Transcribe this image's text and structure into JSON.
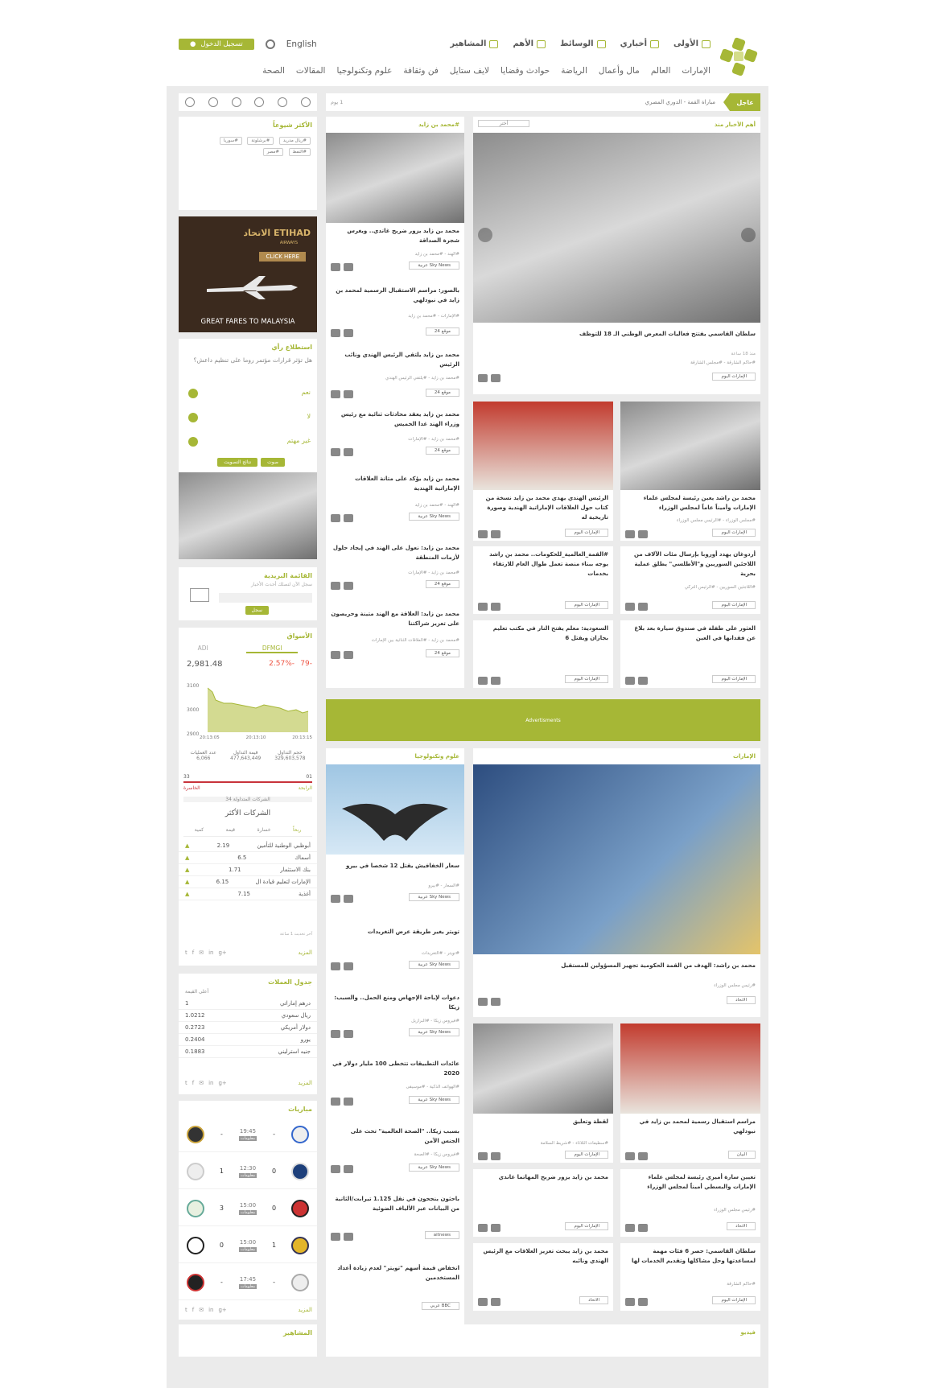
{
  "header": {
    "login_label": "تسجيل الدخول",
    "lang": "English",
    "main_nav": [
      "الأولى",
      "أخباري",
      "الوسائط",
      "الأهم",
      "المشاهير"
    ],
    "sec_nav": [
      "الإمارات",
      "العالم",
      "مال وأعمال",
      "الرياضة",
      "حوادث وقضايا",
      "لايف ستايل",
      "فن وثقافة",
      "علوم وتكنولوجيا",
      "المقالات",
      "الصحة"
    ]
  },
  "ticker": {
    "label": "عاجل",
    "text": "مباراة القمة - الدوري المصري",
    "time": "1 يوم"
  },
  "hero": {
    "section": "أهم الأخبار منذ",
    "filter": "أختر",
    "title": "سلطان القاسمي يفتتح فعاليات المعرض الوطني الـ 18 للتوظف",
    "meta": "منذ 18 ساعة",
    "tag": "#حاكم الشارقة - #مجلس الشارقة",
    "source": "الإمارات اليوم"
  },
  "mid_header": "#محمد بن زايد",
  "mid_cards": [
    {
      "title": "محمد بن زايد يزور ضريح غاندي.. ويغرس شجرة الصداقة",
      "tag": "#الهند - #محمد بن زايد",
      "source": "Sky News عربية"
    },
    {
      "title": "بالصور: مراسم الاستقبال الرسمية لمحمد بن زايد في نيودلهي",
      "tag": "#الإمارات - #محمد بن زايد",
      "source": "موقع 24"
    },
    {
      "title": "محمد بن زايد يلتقي الرئيس الهندي ونائب الرئيس",
      "tag": "#محمد بن زايد - #يلتقي الرئيس الهندي",
      "source": "موقع 24"
    },
    {
      "title": "محمد بن زايد يعقد محادثات ثنائية مع رئيس وزراء الهند غدا الخميس",
      "tag": "#محمد بن زايد - #الإمارات",
      "source": "موقع 24"
    },
    {
      "title": "محمد بن زايد يؤكد على متانة العلاقات الإماراتية الهندية",
      "tag": "#الهند - #محمد بن زايد",
      "source": "Sky News عربية"
    },
    {
      "title": "محمد بن زايد: نعول على الهند في إيجاد حلول لأزمات المنطقة",
      "tag": "#محمد بن زايد - #الإمارات",
      "source": "موقع 24"
    },
    {
      "title": "محمد بن زايد: العلاقة مع الهند متينة وحريصون على تعزيز شراكتنا",
      "tag": "#محمد بن زايد - #العلاقات الثنائية بين الإمارات",
      "source": "موقع 24"
    }
  ],
  "grid_cards": [
    {
      "title": "محمد بن راشد يعين رئيسة لمجلس علماء الإمارات وأميناً عاماً لمجلس الوزراء",
      "tag": "#مجلس الوزراء - #الرئيس مجلس الوزراء",
      "source": "الإمارات اليوم"
    },
    {
      "title": "الرئيس الهندي يهدي محمد بن زايد نسخة من كتاب حول العلاقات الإماراتية الهندية وصورة تاريخية له",
      "tag": "",
      "source": "الإمارات اليوم"
    },
    {
      "title": "أردوغان يهدد أوروبا بإرسال مئات الآلاف من اللاجئين السوريين و\"الأطلسي\" يطلق عملية بحرية",
      "tag": "#اللاجئين السوريين - #الرئيس التركي",
      "source": "الإمارات اليوم"
    },
    {
      "title": "#القمة_العالمية_للحكومات.. محمد بن راشد يوجه ببناء منصة تعمل طوال العام للارتقاء بخدمات",
      "tag": "",
      "source": "الإمارات اليوم"
    },
    {
      "title": "العثور على طفلة في صندوق سيارة بعد بلاغ عن فقدانها في العين",
      "tag": "",
      "source": "الإمارات اليوم"
    },
    {
      "title": "السعودية: معلم يفتح النار في مكتب تعليم بجازان ويقتل 6",
      "tag": "",
      "source": "الإمارات اليوم"
    }
  ],
  "ad_label": "Advertisments",
  "tech_header": "علوم وتكنولوجيا",
  "tech_cards": [
    {
      "title": "سعار الخفافيش يقتل 12 شخصا في بيرو",
      "tag": "#السعار - #بيرو",
      "source": "Sky News عربية"
    },
    {
      "title": "تويتر يغير طريقة عرض التغريدات",
      "tag": "#تويتر - #التغريدات",
      "source": "Sky News عربية"
    },
    {
      "title": "دعوات لإباحة الإجهاض ومنع الحمل.. والسبب: زيكا",
      "tag": "#فيروس زيكا - #البرازيل",
      "source": "Sky News عربية"
    },
    {
      "title": "عائدات التطبيقات تتخطى 100 مليار دولار في 2020",
      "tag": "#الهواتف الذكية - #موسيقى",
      "source": "Sky News عربية"
    },
    {
      "title": "بسبب زيكا.. \"الصحة العالمية\" تحث على الجنس الآمن",
      "tag": "#فيروس زيكا - #الصحة",
      "source": "Sky News عربية"
    },
    {
      "title": "باحثون ينجحون في نقل 1.125 تيرابت/الثانية من البيانات عبر الألياف الضوئية",
      "tag": "",
      "source": "aitnews"
    },
    {
      "title": "انخفاض قيمة أسهم \"تويتر\" لعدم زيادة أعداد المستخدمين",
      "tag": "",
      "source": "BBC عربي"
    }
  ],
  "uae_header": "الإمارات",
  "uae_hero": {
    "title": "محمد بن راشد: الهدف من القمة الحكومية تجهيز المسؤولين للمستقبل",
    "tag": "#رئيس مجلس الوزراء",
    "source": "الاتحاد"
  },
  "uae_cards": [
    {
      "title": "مراسم استقبال رسمية لمحمد بن زايد في نيودلهي",
      "tag": "",
      "source": "البيان"
    },
    {
      "title": "لقطة وتعليق",
      "tag": "#سطيفات الثلاثاء - #شريط السلامة",
      "source": "الإمارات اليوم"
    },
    {
      "title": "تعيين سارة أميري رئيسة لمجلس علماء الإمارات والبسطي أميناً لمجلس الوزراء",
      "tag": "#رئيس مجلس الوزراء",
      "source": "الاتحاد"
    },
    {
      "title": "محمد بن زايد يزور ضريح المهاتما غاندي",
      "tag": "",
      "source": "الإمارات اليوم"
    },
    {
      "title": "سلطان القاسمي: حصر 6 فئات مهمة لمساعدتها وحل مشاكلها وتقديم الخدمات لها",
      "tag": "#حاكم الشارقة",
      "source": "الإمارات اليوم"
    },
    {
      "title": "محمد بن زايد يبحث تعزيز العلاقات مع الرئيس الهندي ونائبه",
      "tag": "",
      "source": "الاتحاد"
    }
  ],
  "trending": {
    "title": "الأكثر شيوعاً",
    "tags": [
      "#ريال مدريد",
      "#برشلونة",
      "#سوريا",
      "#النفط",
      "#مصر"
    ]
  },
  "etihad": {
    "brand": "الاتحاد ETIHAD",
    "sub": "AIRWAYS",
    "cta": "CLICK HERE",
    "tagline": "GREAT FARES TO MALAYSIA"
  },
  "poll": {
    "title": "استطلاع رأي",
    "question": "هل تؤثر قرارات مؤتمر روما على تنظيم داعش؟",
    "options": [
      "نعم",
      "لا",
      "غير مهتم"
    ],
    "vote": "صوت",
    "results": "نتائج التصويت"
  },
  "newsletter": {
    "title": "القائمة البريدية",
    "hint": "سجل الآن لتصلك أحدث الأخبار",
    "button": "سجل"
  },
  "markets": {
    "title": "الأسواق",
    "tabs": [
      "DFMGI",
      "ADI"
    ],
    "value": "2,981.48",
    "change": "-79",
    "pct": "-2.57%",
    "ylabels": [
      "3100",
      "3000",
      "2900"
    ],
    "xlabels": [
      "20:13:05",
      "20:13:10",
      "20:13:15"
    ],
    "stats_labels": [
      "حجم التداول",
      "قيمة التداول",
      "عدد العمليات"
    ],
    "stats_values": [
      "329,603,578",
      "477,643,449",
      "6,066"
    ],
    "up": "01",
    "down": "33",
    "up_lbl": "الرابحة",
    "down_lbl": "الخاسرة",
    "traded": "الشركات المتداولة 34",
    "most": "الشركات الأكثر",
    "cols": [
      "ربحاً",
      "خسارة",
      "قيمة",
      "كمية"
    ],
    "rows": [
      [
        "أبوظبي الوطنية للتأمين",
        "2.19"
      ],
      [
        "أسماك",
        "6.5"
      ],
      [
        "بنك الاستثمار",
        "1.71"
      ],
      [
        "الإمارات لتعليم قيادة ال",
        "6.15"
      ],
      [
        "أغذية",
        "7.15"
      ]
    ],
    "updated": "آخر تحديث 1 ساعة",
    "more": "المزيد"
  },
  "currency": {
    "title": "جدول العملات",
    "col": "أعلى القيمة",
    "rows": [
      [
        "درهم إماراتي",
        "1"
      ],
      [
        "ريال سعودي",
        "1.0212"
      ],
      [
        "دولار أمريكي",
        "0.2723"
      ],
      [
        "يورو",
        "0.2404"
      ],
      [
        "جنيه استرليني",
        "0.1883"
      ]
    ],
    "more": "المزيد"
  },
  "matches": {
    "title": "مباريات",
    "rows": [
      [
        "-",
        "19:45",
        "-"
      ],
      [
        "1",
        "12:30",
        "0"
      ],
      [
        "3",
        "15:00",
        "0"
      ],
      [
        "0",
        "15:00",
        "1"
      ],
      [
        "-",
        "17:45",
        "-"
      ]
    ],
    "info": "معلومات",
    "more": "المزيد"
  },
  "celebs": "المشاهير",
  "video": "فيديو"
}
